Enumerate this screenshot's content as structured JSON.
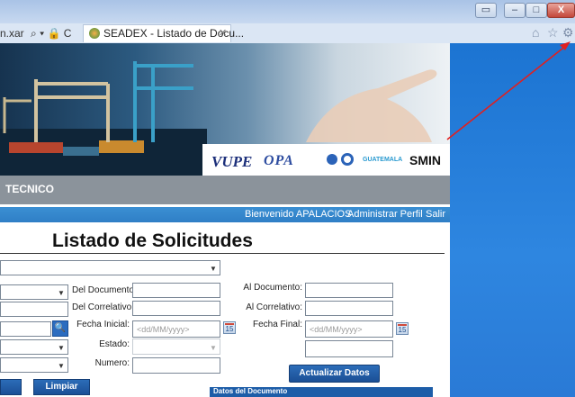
{
  "browser": {
    "address_fragment": "n.xar",
    "address_icons": "⌕ ▾ 🔒 C",
    "tab_title": "SEADEX - Listado de Docu...",
    "tab_close": "✕",
    "nav_icons": {
      "home": "⌂",
      "favorites": "☆",
      "settings": "⚙"
    },
    "window_buttons": {
      "restore_small": "▭",
      "minimize": "–",
      "maximize": "□",
      "close": "X"
    }
  },
  "banner": {
    "logos": {
      "vupe": "VUPE",
      "opa": "OPA",
      "guatemala": "GUATEMALA",
      "smin": "SMIN"
    }
  },
  "navbar": {
    "item": "TECNICO"
  },
  "userbar": {
    "welcome": "Bienvenido APALACIOS",
    "profile": "Administrar Perfil",
    "logout": "Salir"
  },
  "page": {
    "title": "Listado de Solicitudes"
  },
  "form": {
    "del_documento_label": "Del Documento:",
    "del_correlativo_label": "Del Correlativo:",
    "fecha_inicial_label": "Fecha Inicial:",
    "fecha_inicial_placeholder": "<dd/MM/yyyy>",
    "estado_label": "Estado:",
    "numero_label": "Numero:",
    "al_documento_label": "Al Documento:",
    "al_correlativo_label": "Al Correlativo:",
    "fecha_final_label": "Fecha Final:",
    "fecha_final_placeholder": "<dd/MM/yyyy>",
    "calendar_day": "15",
    "dropdown_caret": "▼",
    "search_icon_glyph": "🔍"
  },
  "buttons": {
    "limpiar": "Limpiar",
    "actualizar": "Actualizar Datos"
  },
  "section": {
    "datos_documento": "Datos del Documento"
  },
  "colors": {
    "userbar": "#2f7fc6",
    "navbar": "#8b939b",
    "button_blue": "#1b4f96",
    "side_pane": "#2e86e0",
    "arrow": "#e02020"
  }
}
